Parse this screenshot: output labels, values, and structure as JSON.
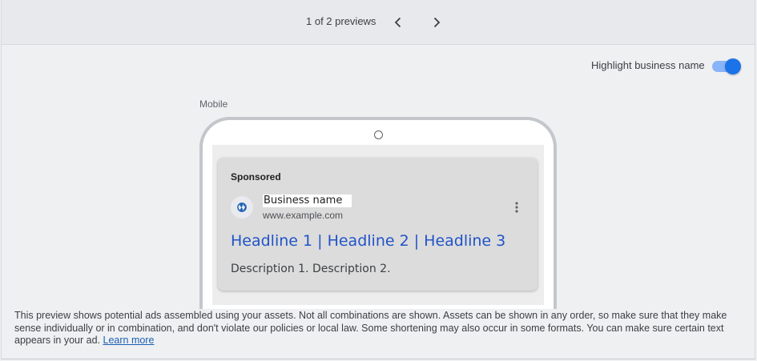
{
  "pager": {
    "text": "1 of 2 previews",
    "prev_icon": "chevron-left-icon",
    "next_icon": "chevron-right-icon"
  },
  "highlight": {
    "label": "Highlight business name",
    "enabled": true,
    "accent": "#1a73e8"
  },
  "preview": {
    "device_label": "Mobile",
    "ad": {
      "sponsored": "Sponsored",
      "favicon_icon": "globe-icon",
      "business_name": "Business name",
      "url": "www.example.com",
      "headline": "Headline 1 | Headline 2 | Headline 3",
      "description": "Description 1. Description 2.",
      "more_icon": "more-vert-icon",
      "headline_color": "#2154c7"
    }
  },
  "footer": {
    "disclaimer": "This preview shows potential ads assembled using your assets. Not all combinations are shown. Assets can be shown in any order, so make sure that they make sense individually or in combination, and don't violate our policies or local law. Some shortening may also occur in some formats. You can make sure certain text appears in your ad.",
    "learn_more": "Learn more"
  }
}
